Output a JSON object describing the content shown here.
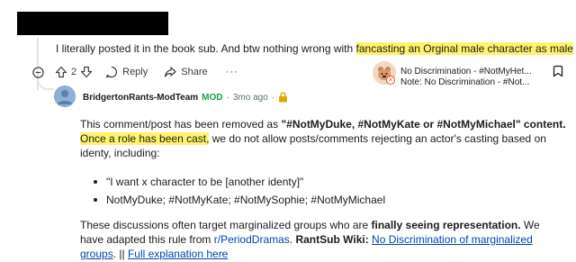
{
  "parent_comment": {
    "text_before": "I literally posted it in the book sub. And btw nothing wrong with ",
    "text_highlight": "fancasting an Orginal male character as male"
  },
  "actions": {
    "vote_count": "2",
    "reply_label": "Reply",
    "share_label": "Share",
    "more_label": "···"
  },
  "user_flair": {
    "line1": "No Discrimination - #NotMyHet...",
    "line2": "Note: No Discrimination - #Not..."
  },
  "mod_comment": {
    "author": "BridgertonRants-ModTeam",
    "badge": "MOD",
    "separator": "·",
    "time": "3mo ago",
    "separator2": "·",
    "p1_a": "This comment/post has been removed as ",
    "p1_bold": "\"#NotMyDuke, #NotMyKate or #NotMyMichael\" content.",
    "p1_space": " ",
    "p1_highlight": "Once a role has been cast,",
    "p1_b": " we do not allow posts/comments rejecting an actor's casting based on identy, including:",
    "bullets": [
      "\"I want x character to be [another identy]\"",
      "NotMyDuke; #NotMyKate; #NotMySophie; #NotMyMichael"
    ],
    "p2_a": "These discussions often target marginalized groups who are ",
    "p2_bold": "finally seeing representation.",
    "p2_b": " We have adapted this rule from ",
    "p2_sub_link": "r/PeriodDramas",
    "p2_c": ". ",
    "p2_wiki_bold": "RantSub Wiki:",
    "p2_d": " ",
    "p2_wiki_link": "No Discrimination of marginalized groups",
    "p2_e": ". || ",
    "p2_full_link": "Full explanation here"
  },
  "colors": {
    "highlight": "#fff36b",
    "mod_green": "#15a045",
    "link_blue": "#0045ac",
    "lock_gold": "#e0a800"
  }
}
